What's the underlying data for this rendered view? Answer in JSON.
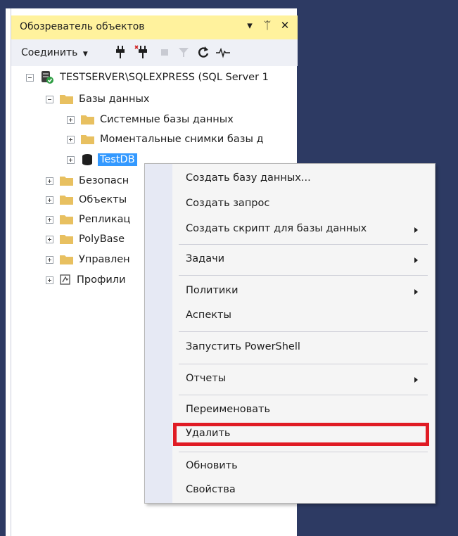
{
  "explorer": {
    "title": "Обозреватель объектов",
    "header_buttons": {
      "dropdown": "▾",
      "pin": "ᛠ",
      "close": "✕"
    },
    "toolbar": {
      "connect_label": "Соединить",
      "icons": [
        "connect-icon",
        "disconnect-icon",
        "stop-icon",
        "filter-icon",
        "refresh-icon",
        "activity-monitor-icon"
      ]
    },
    "tree": {
      "server": "TESTSERVER\\SQLEXPRESS (SQL Server 1",
      "databases": "Базы данных",
      "system_databases": "Системные базы данных",
      "snapshots": "Моментальные снимки базы д",
      "selected_db": "TestDB",
      "security": "Безопасн",
      "server_objects": "Объекты",
      "replication": "Репликац",
      "polybase": "PolyBase",
      "management": "Управлен",
      "profiler": "Профили"
    }
  },
  "context_menu": {
    "items": [
      {
        "label": "Создать базу данных...",
        "submenu": false
      },
      {
        "label": "Создать запрос",
        "submenu": false
      },
      {
        "label": "Создать скрипт для базы данных",
        "submenu": true
      },
      {
        "label": "Задачи",
        "submenu": true
      },
      {
        "label": "Политики",
        "submenu": true
      },
      {
        "label": "Аспекты",
        "submenu": false
      },
      {
        "label": "Запустить PowerShell",
        "submenu": false
      },
      {
        "label": "Отчеты",
        "submenu": true
      },
      {
        "label": "Переименовать",
        "submenu": false
      },
      {
        "label": "Удалить",
        "submenu": false,
        "highlighted": true
      },
      {
        "label": "Обновить",
        "submenu": false
      },
      {
        "label": "Свойства",
        "submenu": false
      }
    ]
  },
  "colors": {
    "frame": "#2d3a63",
    "header": "#fff29d",
    "selection": "#3399ff",
    "highlight_border": "#e01b24",
    "folder": "#e8c060"
  }
}
